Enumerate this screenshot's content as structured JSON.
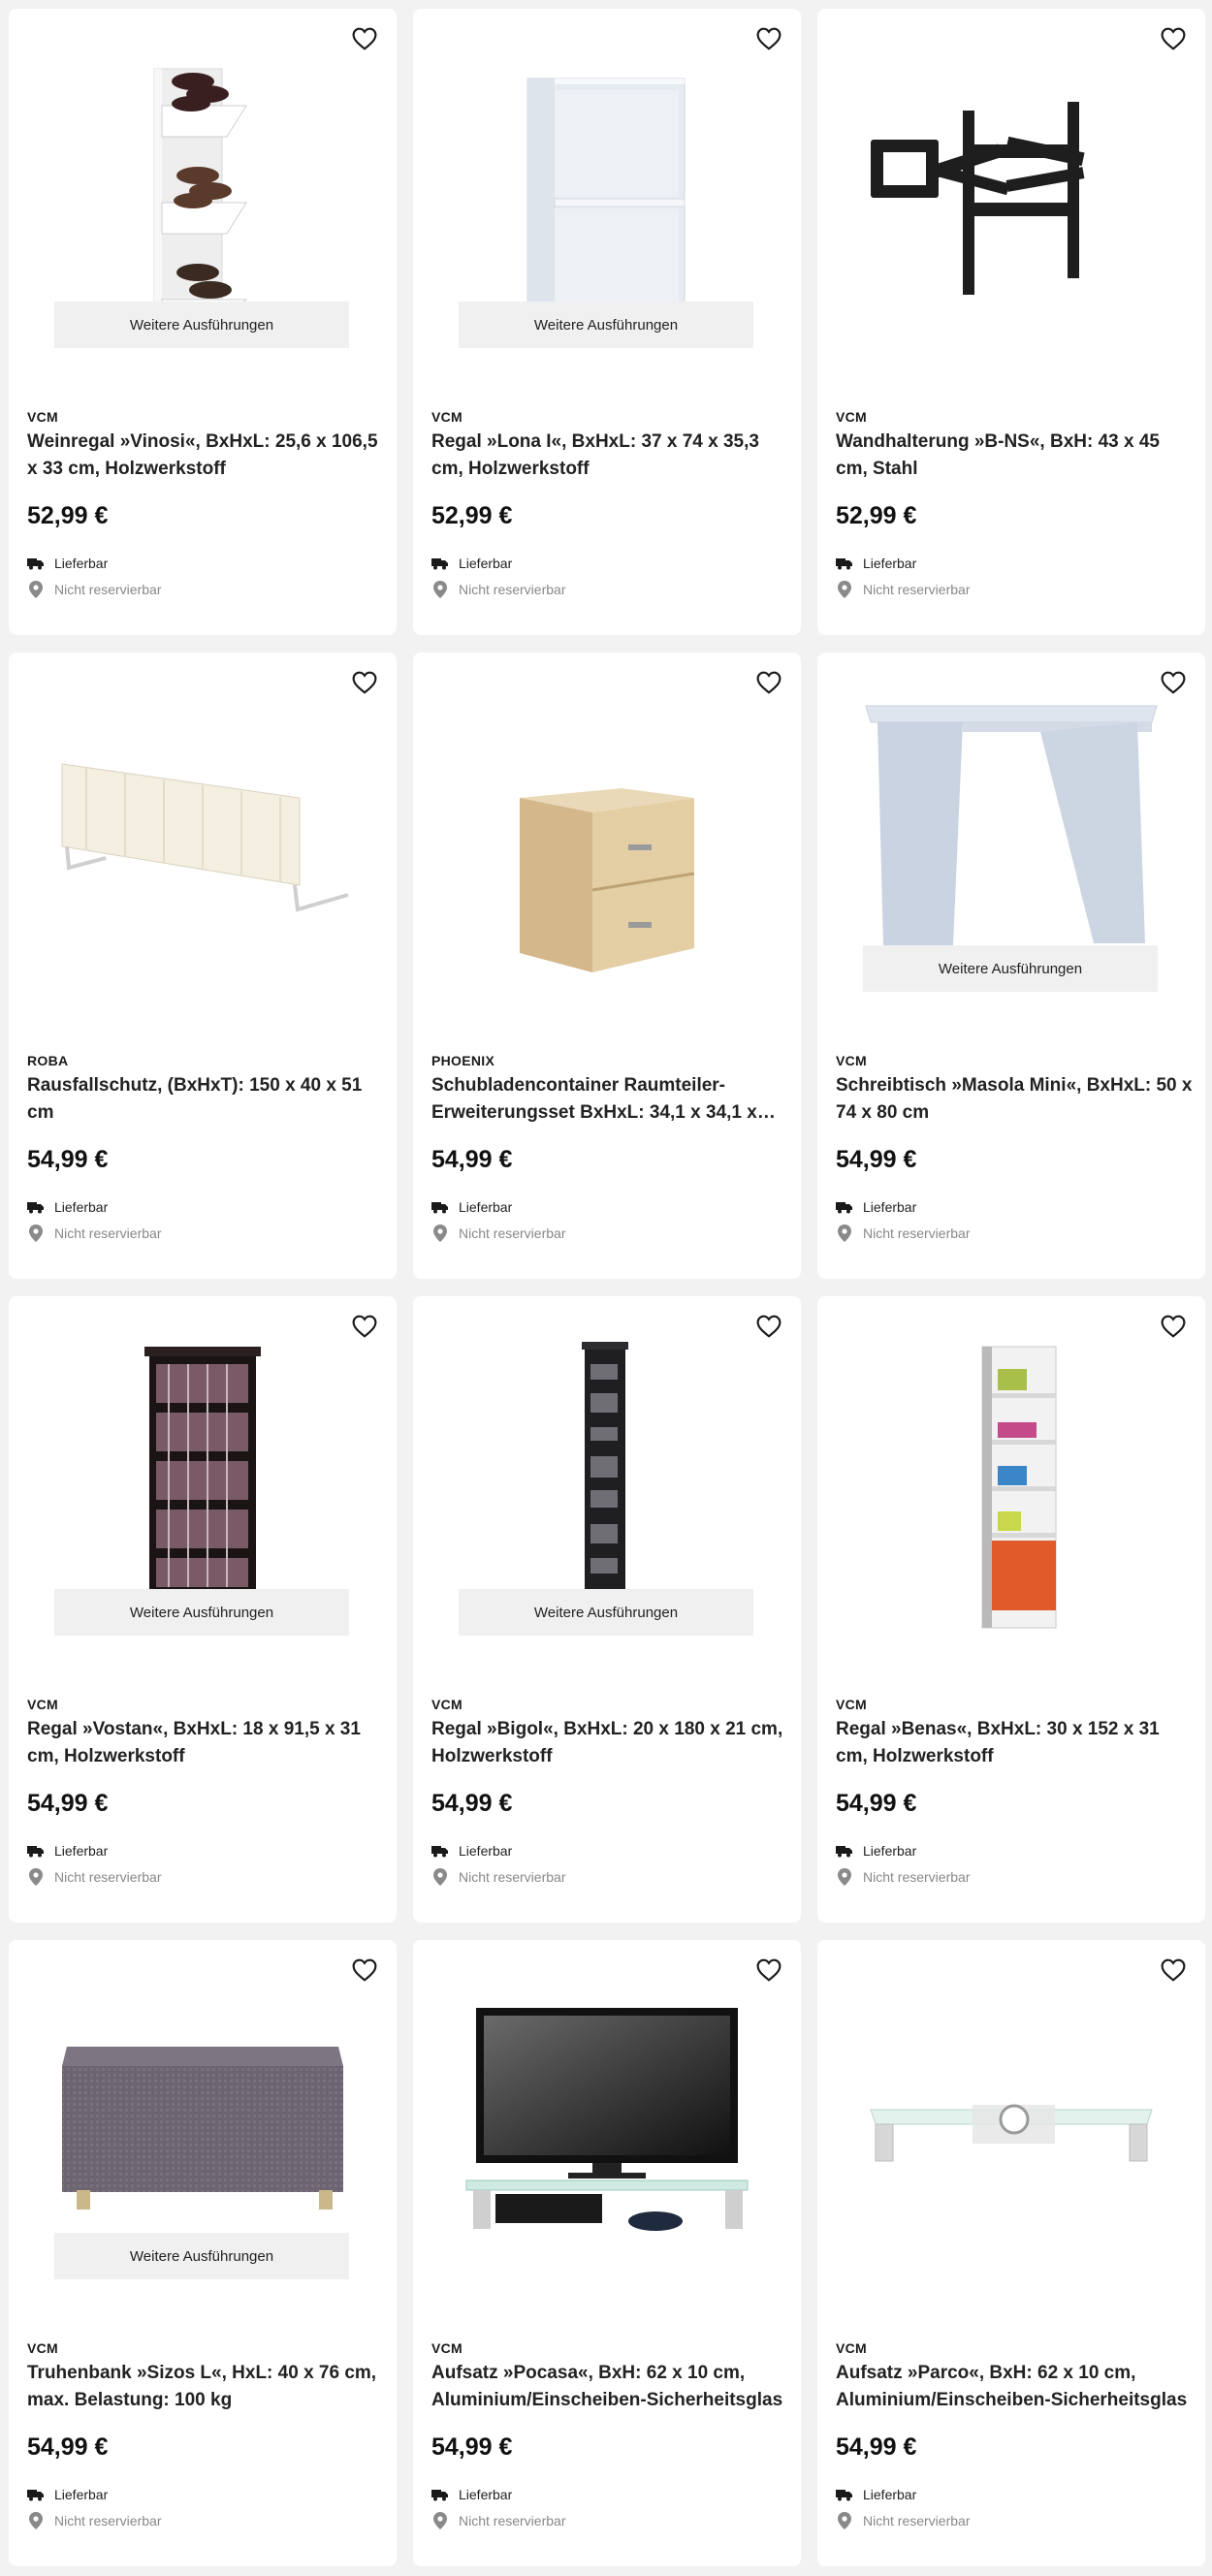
{
  "products": [
    {
      "brand": "VCM",
      "title": "Weinregal »Vinosi«, BxHxL: 25,6 x 106,5 x 33 cm, Holzwerkstoff",
      "price": "52,99 €",
      "variants_label": "Weitere Ausführungen",
      "image": "wine-rack-image"
    },
    {
      "brand": "VCM",
      "title": "Regal »Lona I«, BxHxL: 37 x 74 x 35,3 cm, Holzwerkstoff",
      "price": "52,99 €",
      "variants_label": "Weitere Ausführungen",
      "image": "shelf-image"
    },
    {
      "brand": "VCM",
      "title": "Wandhalterung »B-NS«, BxH: 43 x 45 cm, Stahl",
      "price": "52,99 €",
      "variants_label": "",
      "image": "wall-mount-image"
    },
    {
      "brand": "ROBA",
      "title": "Rausfallschutz, (BxHxT): 150 x 40 x 51 cm",
      "price": "54,99 €",
      "variants_label": "",
      "image": "bed-rail-image"
    },
    {
      "brand": "PHOENIX",
      "title": "Schubladencontainer Raumteiler-Erweiterungsset BxHxL: 34,1 x 34,1 x…",
      "price": "54,99 €",
      "variants_label": "",
      "image": "drawer-box-image"
    },
    {
      "brand": "VCM",
      "title": "Schreibtisch »Masola Mini«, BxHxL: 50 x 74 x 80 cm",
      "price": "54,99 €",
      "variants_label": "Weitere Ausführungen",
      "image": "desk-image"
    },
    {
      "brand": "VCM",
      "title": "Regal »Vostan«, BxHxL: 18 x 91,5 x 31 cm, Holzwerkstoff",
      "price": "54,99 €",
      "variants_label": "Weitere Ausführungen",
      "image": "cd-shelf-image"
    },
    {
      "brand": "VCM",
      "title": "Regal »Bigol«, BxHxL: 20 x 180 x 21 cm, Holzwerkstoff",
      "price": "54,99 €",
      "variants_label": "Weitere Ausführungen",
      "image": "tall-shelf-image"
    },
    {
      "brand": "VCM",
      "title": "Regal »Benas«, BxHxL: 30 x 152 x 31 cm, Holzwerkstoff",
      "price": "54,99 €",
      "variants_label": "",
      "image": "column-shelf-image"
    },
    {
      "brand": "VCM",
      "title": "Truhenbank »Sizos L«, HxL: 40 x 76 cm, max. Belastung: 100 kg",
      "price": "54,99 €",
      "variants_label": "Weitere Ausführungen",
      "image": "storage-bench-image"
    },
    {
      "brand": "VCM",
      "title": "Aufsatz »Pocasa«, BxH: 62 x 10 cm, Aluminium/Einscheiben-Sicherheitsglas",
      "price": "54,99 €",
      "variants_label": "",
      "image": "tv-stand-image"
    },
    {
      "brand": "VCM",
      "title": "Aufsatz »Parco«, BxH: 62 x 10 cm, Aluminium/Einscheiben-Sicherheitsglas",
      "price": "54,99 €",
      "variants_label": "",
      "image": "monitor-stand-image"
    }
  ],
  "labels": {
    "delivery": "Lieferbar",
    "reserve": "Nicht reservierbar"
  },
  "colors": {
    "background": "#f2f2f2",
    "card": "#ffffff",
    "variants_button": "#f0f0f0",
    "muted_text": "#888888"
  }
}
